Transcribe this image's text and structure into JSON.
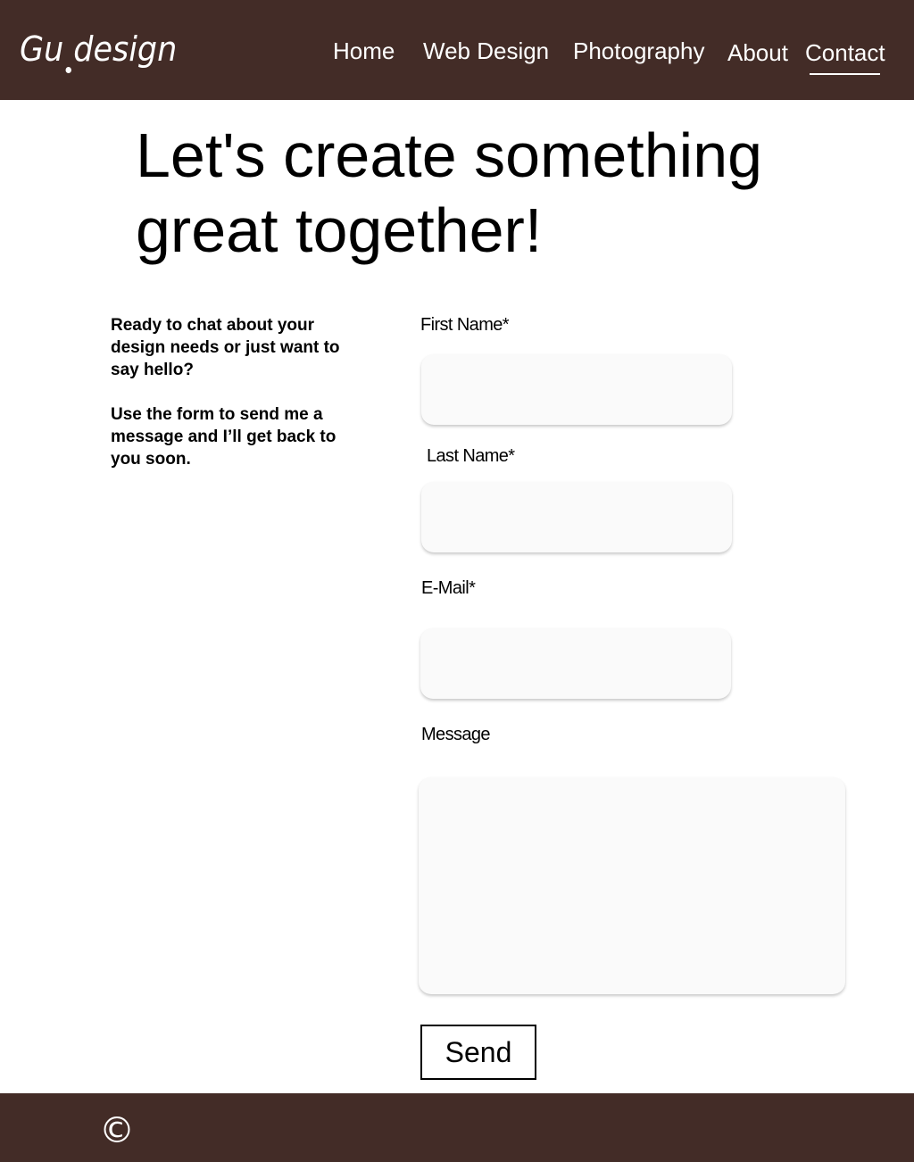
{
  "header": {
    "logo_left": "Gu",
    "logo_right": "design",
    "nav": {
      "home": "Home",
      "web_design": "Web Design",
      "photography": "Photography",
      "about": "About",
      "contact": "Contact"
    },
    "active_item": "Contact"
  },
  "hero": {
    "headline": "Let's create something great together!"
  },
  "intro": {
    "paragraph_1": "Ready to chat about your design needs or just want to say hello?",
    "paragraph_2": "Use the form to send me a message and I’ll get back to you soon."
  },
  "form": {
    "first_name_label": "First Name*",
    "first_name_value": "",
    "last_name_label": "Last Name*",
    "last_name_value": "",
    "email_label": "E-Mail*",
    "email_value": "",
    "message_label": "Message",
    "message_value": "",
    "send_label": "Send"
  },
  "footer": {
    "copyright_symbol": "©"
  },
  "colors": {
    "brand_brown": "#432c27",
    "field_background": "#fafafa",
    "text": "#000000"
  }
}
